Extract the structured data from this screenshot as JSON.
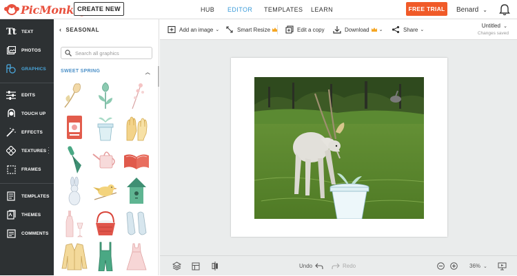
{
  "app": {
    "brand": "PicMonkey"
  },
  "topbar": {
    "create_label": "CREATE NEW",
    "nav": [
      {
        "label": "HUB"
      },
      {
        "label": "EDITOR"
      },
      {
        "label": "TEMPLATES"
      },
      {
        "label": "LEARN"
      }
    ],
    "trial_label": "FREE TRIAL",
    "user_name": "Benard"
  },
  "rail": {
    "items": [
      {
        "label": "TEXT",
        "icon": "text-icon"
      },
      {
        "label": "PHOTOS",
        "icon": "photos-icon"
      },
      {
        "label": "GRAPHICS",
        "icon": "graphics-icon"
      },
      {
        "label": "EDITS",
        "icon": "sliders-icon"
      },
      {
        "label": "TOUCH UP",
        "icon": "face-icon"
      },
      {
        "label": "EFFECTS",
        "icon": "wand-icon"
      },
      {
        "label": "TEXTURES",
        "icon": "textures-icon"
      },
      {
        "label": "FRAMES",
        "icon": "frame-icon"
      },
      {
        "label": "TEMPLATES",
        "icon": "templates-icon"
      },
      {
        "label": "THEMES",
        "icon": "themes-icon"
      },
      {
        "label": "COMMENTS",
        "icon": "comment-icon"
      }
    ],
    "active": "GRAPHICS"
  },
  "panel": {
    "back_label": "SEASONAL",
    "search_placeholder": "Search all graphics",
    "section_title": "SWEET SPRING",
    "graphics": [
      "tulip-graphic",
      "flower-graphic",
      "sprig-graphic",
      "seed-packet-graphic",
      "pot-graphic",
      "gloves-graphic",
      "trowel-graphic",
      "watering-can-graphic",
      "book-graphic",
      "bunny-graphic",
      "bird-graphic",
      "birdhouse-graphic",
      "bottle-graphic",
      "basket-graphic",
      "flats-graphic",
      "cardigan-graphic",
      "overalls-graphic",
      "dress-graphic"
    ]
  },
  "toolbar": {
    "add_image": "Add an image",
    "smart_resize": "Smart Resize",
    "edit_copy": "Edit a copy",
    "download": "Download",
    "share": "Share",
    "doc_name": "Untitled",
    "doc_status": "Changes saved"
  },
  "bottombar": {
    "undo": "Undo",
    "redo": "Redo",
    "zoom": "36%"
  },
  "colors": {
    "brand": "#e8513e",
    "accent": "#3a9bd9",
    "trial": "#f05a28",
    "rail": "#2d3133"
  }
}
